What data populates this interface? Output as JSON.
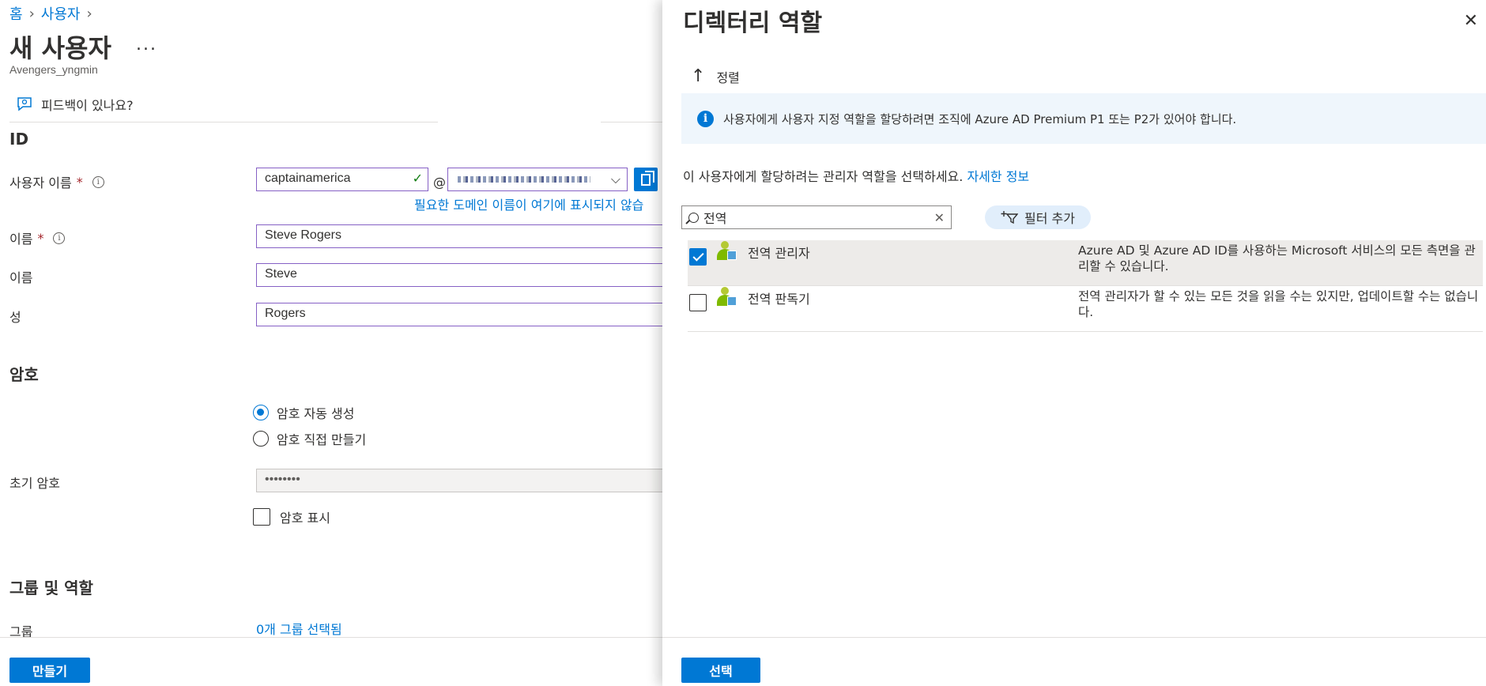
{
  "breadcrumb": {
    "home": "홈",
    "users": "사용자"
  },
  "page": {
    "title": "새 사용자",
    "more": "...",
    "tenant": "Avengers_yngmin"
  },
  "feedback": {
    "label": "피드백이 있나요?"
  },
  "identity": {
    "heading": "ID",
    "username_label": "사용자 이름",
    "username_value": "captainamerica",
    "at_sign": "@",
    "domain_hint": "필요한 도메인 이름이 여기에 표시되지 않습",
    "name_label": "이름",
    "name_value": "Steve Rogers",
    "first_name_label": "이름",
    "first_name_value": "Steve",
    "last_name_label": "성",
    "last_name_value": "Rogers",
    "required_mark": "*"
  },
  "password": {
    "heading": "암호",
    "auto_generate": "암호 자동 생성",
    "create_own": "암호 직접 만들기",
    "initial_label": "초기 암호",
    "initial_value": "••••••••",
    "show_password": "암호 표시"
  },
  "groups_roles": {
    "heading": "그룹 및 역할",
    "groups_label": "그룹",
    "groups_link": "0개 그룹 선택됨"
  },
  "left_footer": {
    "create_button": "만들기"
  },
  "panel": {
    "title": "디렉터리 역할",
    "sort_label": "정렬",
    "info_text": "사용자에게 사용자 지정 역할을 할당하려면 조직에 Azure AD Premium P1 또는 P2가 있어야 합니다.",
    "description": "이 사용자에게 할당하려는 관리자 역할을 선택하세요. ",
    "learn_more": "자세한 정보",
    "search_value": "전역",
    "filter_label": "필터 추가",
    "roles": [
      {
        "name": "전역 관리자",
        "description": "Azure AD 및 Azure AD ID를 사용하는 Microsoft 서비스의 모든 측면을 관리할 수 있습니다.",
        "selected": true
      },
      {
        "name": "전역 판독기",
        "description": "전역 관리자가 할 수 있는 모든 것을 읽을 수는 있지만, 업데이트할 수는 없습니다.",
        "selected": false
      }
    ],
    "select_button": "선택"
  },
  "colors": {
    "accent": "#0078d4",
    "input_border": "#8661c5",
    "info_bg": "#eff6fc",
    "selected_row": "#edebe9"
  }
}
